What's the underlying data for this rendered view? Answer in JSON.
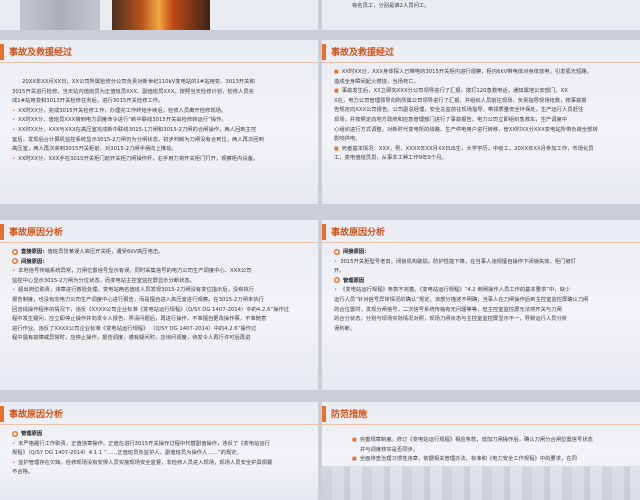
{
  "top_right_text": "有名员工，分别是谁2人员问工。",
  "panel1": {
    "title": "事故及救援经过",
    "paras": [
      "20XX年XX月XX日，XX公司所属检修分公司负责对新世纪110kV变电站的1#站用变、3013开关和",
      "3015开关进行检修。当天站内值班员为正值班员XXX、副值班员XXX。按照当天检修计划，检修人员完",
      "成1#站用变和3013开关检修任务后，进行3015开关检修工作。"
    ],
    "bullets": [
      "XX时XX分，完成3015开关检修工作，办理完工作终结手续后，检修人员离开检修现场。",
      "XX时XX分，值班员XXX接到电力调度命令进行“新中联线3015开关由检修转运行”操作。",
      "XX时XX分，XXX与XXX在高压室完成新中联线3015-1刀闸和3015-2刀闸的合闸操作，两人回到主控",
      "室后，发现后台计算机监控系统显示3015-2刀闸仍为分闸状态，初步判断为刀闸没有合到位，两人再次回到",
      "高压室，两人再次来到3015开关柜前，对3015-2刀闸手柄向上推动。",
      "XX时XX分，XXX手在3015开关柜门前开关柜刀闸操作杆，右手用力将开关柜门打开，观察柜内设备。"
    ]
  },
  "panel2": {
    "title": "事故及救援经过",
    "bullets": [
      "XX时XX分，XXX身体探入已带电的3015开关柜内进行观察，柜内6kV带电体对身体放电，引发弧光短路，",
      "造成全身瞬间起火燃烧，当场死亡。",
      "事故发生后，XX立即向XXX分公司领导进行了汇报，拨打120急救电话，通知属地公安部门。XX",
      "X在，电力公司管理领导向所所属公司领导进行了汇报，并组织人员前往现场，负责指导现场抢救，按事故报",
      "告规定向XXX公司报告。公司副总经理，安全总监前往现场指导，带领质量安全环保处，生产运行人员赶往",
      "现场，并按照定向地方政府和应急管理部门进行了事故报告。电力公司立即组织急救车，生产调度中",
      "心组织进行方式调整，对新时代变电所的线路、生产供电用户进行转移，管XX时XX分XXX变电站所带负荷全部转",
      "影响供电。",
      "死者基本情况：XXX，男，XXXX年XX月XX日出生，大学学历，中级工，20XX年XX月参加工作，市场化员",
      "工，变电值班员员，从事本工种工作9年9个月。"
    ]
  },
  "panel3": {
    "title": "事故原因分析",
    "h1": "直接原因：",
    "h1_text": "值班员张某误入高压开关柜，遭受6kV高压电击。",
    "h2": "间接原因：",
    "lines": [
      "本地信号传输系统异常，刀闸位置信号显示有误。同时采集信号的电力公司生产调度中心、XXX公司",
      "监控中心显示3015-2刀闸为分位状态，而变电站主控室监控屏显示分断状态。",
      "超出岗位职责，违章进行救险处理。变电站两名值班人员发现3015-2刀闸没有变位指示后，没有执行",
      "报告制度，也没有向电力公司生产调度中心进行报告，而是擅自进入高压室进行观察。在3015-2刀闸未执行",
      "回流线操作程序的情况下，违反《XXXX公司企业标准《变电站运行规程》（Q/SY DG 1407-2014）中的4.2.6“操作过",
      "程中发生疑问，应立即停止操作并向发令人报告，弄清问题后，再进行操作，不准擅自更改操作票，不准随意",
      "进行作业。违反了XXXX公司企业标准《变电站运行规程》 （Q/SY DG 1407-2014）中的4.2.6“操作过",
      "程中遇有故障或异常时，应停止操作，报告调度，遵有疑问时，应询问调度，待发令人再行许可后再进",
      "行操作”的规定。"
    ]
  },
  "panel4": {
    "title": "事故原因分析",
    "h": "间接原因：",
    "lines": [
      "3015开关柜型号老旧，闭锁机构破损，防护性能下降，在当事人违规擅自操作下闭锁失效，柜门被打",
      "开。",
      "管理原因",
      "《变电站运行规程》条款不完善。《变电站运行规程》“4.2 倒闸操作人员工作的基本要求”中，缺少",
      "运行人员“针对信号异常情况的确认”规定，该部分描述不明确，当事人在刀闸操作后到主控室监控屏确认刀闸",
      "的合位置时，发现分闸信号，二次信号系统传输有无问题等等，但主控室监控屏无法将开关与刀闸",
      "的合分状态，分别与现场实际情况对照，现场刀闸状态与主控室监控屏显示不一，导致运行人员分析",
      "误判断。"
    ]
  },
  "panel5": {
    "title": "事故原因分析",
    "h": "管理原因",
    "lines": [
      "未严格履行工作职责，正值违章操作。正值在进行3015开关操作过程中代替副值操作，违反了《变电站运行",
      "规程》（Q/SY DG 1407-2014）4.1.1 “……正值班员负监护人，副值班员为操作人……”的规定。",
      "监护管理存在欠缺，检修现场没有安排人员实施现场安全监督，非检修人员进入现场，现场人员安全护具佩戴",
      "不合格。"
    ]
  },
  "panel6": {
    "title": "防范措施",
    "lines": [
      "完善规章制度。修订《变电站运行规程》相应条款，增加刀闸操作后，确认刀闸分合闸位置信号状态",
      "并与调度核实是否同步。",
      "全面排查治理习惯性违章，依据相关管理办法、标准和《电力安全工作规程》中的要求，在同"
    ]
  }
}
